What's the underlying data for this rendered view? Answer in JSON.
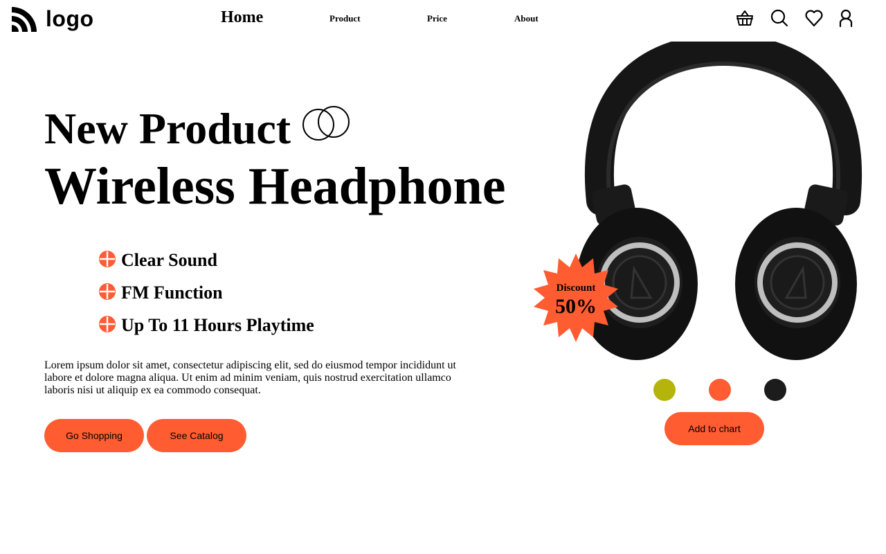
{
  "header": {
    "logo_text": "logo",
    "nav": {
      "home": "Home",
      "product": "Product",
      "price": "Price",
      "about": "About"
    },
    "icons": [
      "basket-icon",
      "search-icon",
      "heart-icon",
      "user-icon"
    ]
  },
  "hero": {
    "headline_1": "New Product",
    "headline_2": "Wireless Headphone",
    "features": [
      "Clear Sound",
      "FM Function",
      "Up To 11 Hours Playtime"
    ],
    "description": "Lorem ipsum dolor sit amet, consectetur adipiscing elit, sed do eiusmod tempor incididunt ut labore et dolore magna aliqua. Ut enim ad minim veniam, quis nostrud exercitation ullamco laboris nisi ut aliquip ex ea commodo consequat.",
    "buttons": {
      "shop": "Go Shopping",
      "catalog": "See Catalog"
    }
  },
  "product": {
    "badge": {
      "label": "Discount",
      "value": "50%"
    },
    "colors": [
      "#b5b40a",
      "#ff5c32",
      "#1c1c1c"
    ],
    "add_to_cart": "Add to chart"
  },
  "theme": {
    "accent": "#ff5c32",
    "text": "#000000",
    "background": "#ffffff"
  }
}
